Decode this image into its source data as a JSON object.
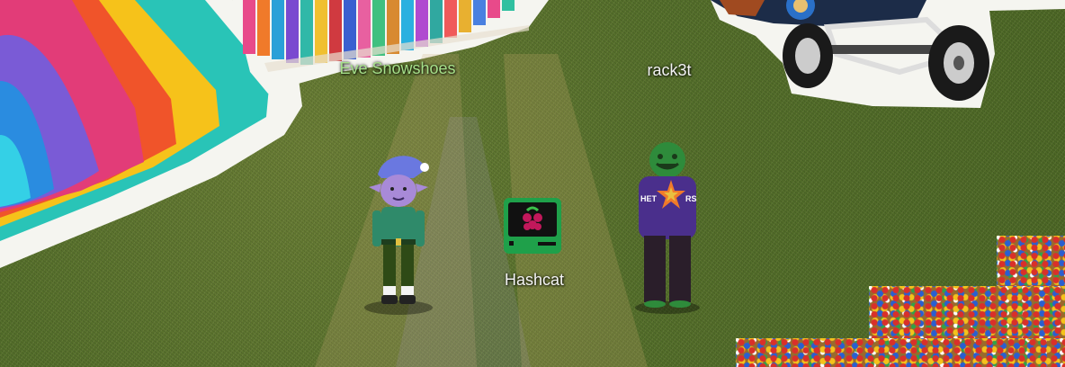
{
  "players": {
    "elf": {
      "name": "Eve Snowshoes",
      "name_color": "#a6e08a"
    },
    "avatar": {
      "name": "rack3t",
      "name_color": "#f4f4f4",
      "shirt_text": "HET RS"
    }
  },
  "objects": {
    "terminal": {
      "label": "Hashcat"
    }
  },
  "colors": {
    "grass": "#54702a",
    "elf_body": "#2f8a6a",
    "elf_skin": "#a88ad8",
    "avatar_skin": "#2e8b3b",
    "avatar_shirt": "#4a2f8c",
    "terminal_frame": "#1fa04a",
    "raspberry": "#c2185b"
  },
  "icons": {
    "terminal": "raspberry-pi-terminal-icon",
    "shirt_logo": "starfish-icon",
    "vehicle": "go-kart-icon"
  }
}
